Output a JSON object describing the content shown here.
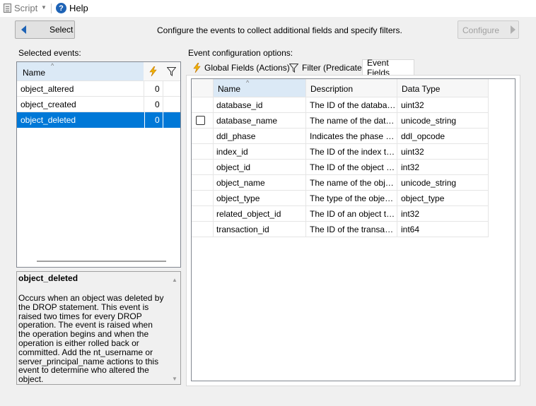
{
  "toolbar": {
    "script_label": "Script",
    "help_label": "Help"
  },
  "nav": {
    "select_label": "Select",
    "instruction": "Configure the events to collect additional fields and specify filters.",
    "configure_label": "Configure"
  },
  "left": {
    "title": "Selected events:",
    "header_name": "Name",
    "events": [
      {
        "name": "object_altered",
        "count": "0"
      },
      {
        "name": "object_created",
        "count": "0"
      },
      {
        "name": "object_deleted",
        "count": "0"
      }
    ],
    "desc_title": "object_deleted",
    "desc_text": "Occurs when an object was deleted by the DROP statement. This event is raised two times for every DROP operation. The event is raised when the operation begins and when the operation is either rolled back or committed. Add the nt_username or server_principal_name actions to this event to determine who altered the object."
  },
  "right": {
    "title": "Event configuration options:",
    "tabs": [
      "Global Fields (Actions)",
      "Filter (Predicate)",
      "Event Fields"
    ],
    "columns": [
      "Name",
      "Description",
      "Data Type"
    ],
    "rows": [
      {
        "name": "database_id",
        "description": "The ID of the database t...",
        "type": "uint32"
      },
      {
        "name": "database_name",
        "description": "The name of the databa...",
        "type": "unicode_string"
      },
      {
        "name": "ddl_phase",
        "description": "Indicates the phase of th...",
        "type": "ddl_opcode"
      },
      {
        "name": "index_id",
        "description": "The ID of the index that ...",
        "type": "uint32"
      },
      {
        "name": "object_id",
        "description": "The ID of the object that...",
        "type": "int32"
      },
      {
        "name": "object_name",
        "description": "The name of the object t...",
        "type": "unicode_string"
      },
      {
        "name": "object_type",
        "description": "The type of the object th...",
        "type": "object_type"
      },
      {
        "name": "related_object_id",
        "description": "The ID of an object that ...",
        "type": "int32"
      },
      {
        "name": "transaction_id",
        "description": "The ID of the transactio...",
        "type": "int64"
      }
    ]
  },
  "colors": {
    "selection": "#0078d7",
    "header": "#f7f7f7",
    "header_sorted": "#dbe9f6",
    "help_icon": "#1e63b6"
  },
  "icons": {
    "script": "script-icon",
    "help": "help-icon",
    "back": "back-arrow-icon",
    "forward": "forward-arrow-icon",
    "action": "lightning-icon",
    "filter": "filter-icon",
    "dropdown": "dropdown-arrow-icon"
  }
}
